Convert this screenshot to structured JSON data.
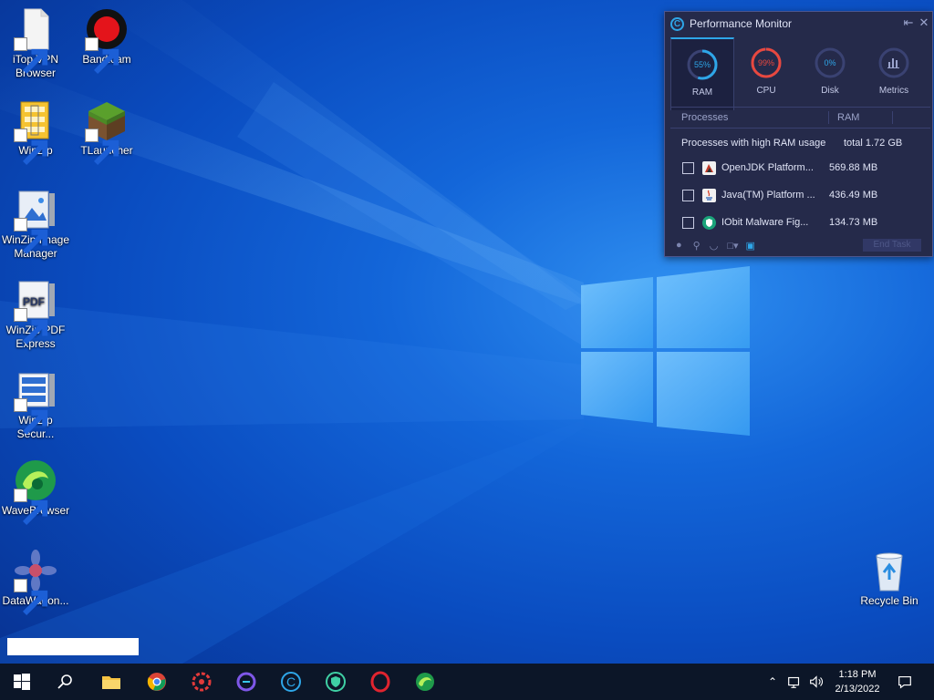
{
  "desktop": {
    "icons": [
      {
        "label": "iTop VPN\nBrowser",
        "icon": "document-icon"
      },
      {
        "label": "Bandicam",
        "icon": "record-icon"
      },
      {
        "label": "WinZip",
        "icon": "zip-icon"
      },
      {
        "label": "TLauncher",
        "icon": "grass-block-icon"
      },
      {
        "label": "WinZip Image\nManager",
        "icon": "image-zip-icon"
      },
      {
        "label": "WinZip PDF\nExpress",
        "icon": "pdf-icon"
      },
      {
        "label": "WinZip\nSecur...",
        "icon": "secure-zip-icon"
      },
      {
        "label": "WaveBrowser",
        "icon": "wave-icon"
      },
      {
        "label": "DataWagon...",
        "icon": "gear-flower-icon"
      },
      {
        "label": "Recycle Bin",
        "icon": "recycle-bin-icon"
      }
    ]
  },
  "perf": {
    "title": "Performance Monitor",
    "tabs": [
      {
        "label": "RAM",
        "value": "55%",
        "pct": 55,
        "color": "#2ea6e8"
      },
      {
        "label": "CPU",
        "value": "99%",
        "pct": 99,
        "color": "#e8483f"
      },
      {
        "label": "Disk",
        "value": "0%",
        "pct": 0,
        "color": "#2ea6e8"
      },
      {
        "label": "Metrics",
        "icon": "bar-chart-icon"
      }
    ],
    "columns": [
      "Processes",
      "RAM"
    ],
    "summary_label": "Processes with high RAM usage",
    "summary_total": "total 1.72 GB",
    "processes": [
      {
        "name": "OpenJDK Platform...",
        "ram": "569.88 MB"
      },
      {
        "name": "Java(TM) Platform ...",
        "ram": "436.49 MB"
      },
      {
        "name": "IObit Malware Fig...",
        "ram": "134.73 MB"
      }
    ],
    "end_task": "End Task"
  },
  "taskbar": {
    "time": "1:18 PM",
    "date": "2/13/2022"
  }
}
